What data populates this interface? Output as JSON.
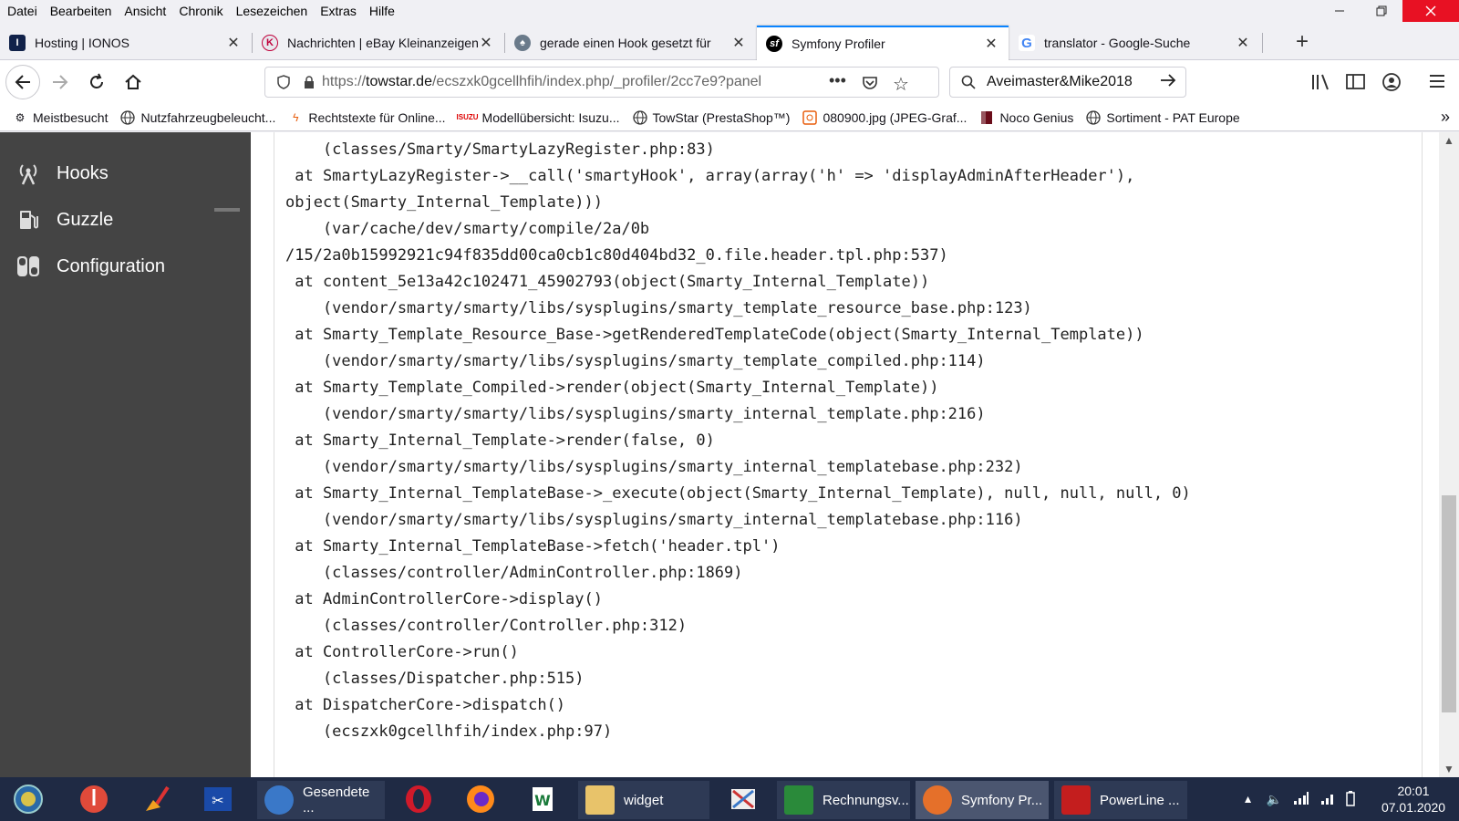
{
  "menu": [
    "Datei",
    "Bearbeiten",
    "Ansicht",
    "Chronik",
    "Lesezeichen",
    "Extras",
    "Hilfe"
  ],
  "tabs": [
    {
      "title": "Hosting | IONOS",
      "fav": "I",
      "fav_color": "#11224a"
    },
    {
      "title": "Nachrichten | eBay Kleinanzeigen",
      "fav": "K",
      "fav_color": "#d9d9e0"
    },
    {
      "title": "gerade einen Hook gesetzt für",
      "fav": "♠",
      "fav_color": "#6a7a8a"
    },
    {
      "title": "Symfony Profiler",
      "fav": "sf",
      "fav_color": "#000000"
    },
    {
      "title": "translator - Google-Suche",
      "fav": "G",
      "fav_color": "#ffffff"
    }
  ],
  "url": {
    "scheme": "https://",
    "host": "towstar.de",
    "path": "/ecszxk0gcellhfih/index.php/_profiler/2cc7e9?panel"
  },
  "search": {
    "value": "Aveimaster&Mike2018"
  },
  "bookmarks": [
    {
      "label": "Meistbesucht",
      "icon": "gear-icon"
    },
    {
      "label": "Nutzfahrzeugbeleucht...",
      "icon": "globe-icon"
    },
    {
      "label": "Rechtstexte für Online...",
      "icon": "lightning-icon"
    },
    {
      "label": "Modellübersicht: Isuzu...",
      "icon": "isuzu-icon"
    },
    {
      "label": "TowStar (PrestaShop™)",
      "icon": "globe-icon"
    },
    {
      "label": "080900.jpg (JPEG-Graf...",
      "icon": "image-icon"
    },
    {
      "label": "Noco Genius",
      "icon": "noco-icon"
    },
    {
      "label": "Sortiment - PAT Europe",
      "icon": "globe-icon"
    }
  ],
  "sidebar": {
    "items": [
      {
        "label": "Hooks",
        "icon": "antenna-icon"
      },
      {
        "label": "Guzzle",
        "icon": "fuel-icon"
      },
      {
        "label": "Configuration",
        "icon": "toggle-icon"
      }
    ]
  },
  "trace": [
    "    (classes/Smarty/SmartyLazyRegister.php:83)",
    " at SmartyLazyRegister->__call('smartyHook', array(array('h' => 'displayAdminAfterHeader'),",
    "object(Smarty_Internal_Template)))",
    "    (var/cache/dev/smarty/compile/2a/0b",
    "/15/2a0b15992921c94f835dd00ca0cb1c80d404bd32_0.file.header.tpl.php:537)",
    " at content_5e13a42c102471_45902793(object(Smarty_Internal_Template))",
    "    (vendor/smarty/smarty/libs/sysplugins/smarty_template_resource_base.php:123)",
    " at Smarty_Template_Resource_Base->getRenderedTemplateCode(object(Smarty_Internal_Template))",
    "    (vendor/smarty/smarty/libs/sysplugins/smarty_template_compiled.php:114)",
    " at Smarty_Template_Compiled->render(object(Smarty_Internal_Template))",
    "    (vendor/smarty/smarty/libs/sysplugins/smarty_internal_template.php:216)",
    " at Smarty_Internal_Template->render(false, 0)",
    "    (vendor/smarty/smarty/libs/sysplugins/smarty_internal_templatebase.php:232)",
    " at Smarty_Internal_TemplateBase->_execute(object(Smarty_Internal_Template), null, null, null, 0)",
    "    (vendor/smarty/smarty/libs/sysplugins/smarty_internal_templatebase.php:116)",
    " at Smarty_Internal_TemplateBase->fetch('header.tpl')",
    "    (classes/controller/AdminController.php:1869)",
    " at AdminControllerCore->display()",
    "    (classes/controller/Controller.php:312)",
    " at ControllerCore->run()",
    "    (classes/Dispatcher.php:515)",
    " at DispatcherCore->dispatch()",
    "    (ecszxk0gcellhfih/index.php:97)"
  ],
  "taskbar": {
    "apps": [
      {
        "label": "Gesendete ...",
        "color": "#3a78c8"
      },
      {
        "label": "widget",
        "color": "#e8c36a"
      },
      {
        "label": "Rechnungsv...",
        "color": "#2a8a3a"
      },
      {
        "label": "Symfony Pr...",
        "color": "#e5702a"
      },
      {
        "label": "PowerLine ...",
        "color": "#c41e1e"
      }
    ],
    "time": "20:01",
    "date": "07.01.2020"
  }
}
